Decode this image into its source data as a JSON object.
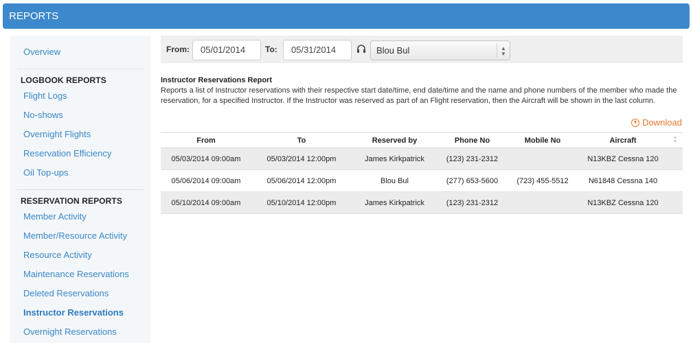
{
  "header": {
    "title": "REPORTS"
  },
  "sidebar": {
    "overview": "Overview",
    "sections": [
      {
        "heading": "LOGBOOK REPORTS",
        "items": [
          "Flight Logs",
          "No-shows",
          "Overnight Flights",
          "Reservation Efficiency",
          "Oil Top-ups"
        ]
      },
      {
        "heading": "RESERVATION REPORTS",
        "items": [
          "Member Activity",
          "Member/Resource Activity",
          "Resource Activity",
          "Maintenance Reservations",
          "Deleted Reservations",
          "Instructor Reservations",
          "Overnight Reservations"
        ]
      }
    ],
    "active_item": "Instructor Reservations"
  },
  "filters": {
    "from_label": "From:",
    "from_value": "05/01/2014",
    "to_label": "To:",
    "to_value": "05/31/2014",
    "instructor_icon": "headset-icon",
    "instructor_selected": "Blou Bul"
  },
  "report": {
    "title": "Instructor Reservations Report",
    "description": "Reports a list of Instructor reservations with their respective start date/time, end date/time and the name and phone numbers of the member who made the reservation, for a specified Instructor. If the Instructor was reserved as part of an Flight reservation, then the Aircraft will be shown in the last column.",
    "download_label": "Download",
    "download_icon": "download-circle-icon",
    "accent_color": "#e8772e"
  },
  "table": {
    "columns": [
      "From",
      "To",
      "Reserved by",
      "Phone No",
      "Mobile No",
      "Aircraft"
    ],
    "rows": [
      [
        "05/03/2014 09:00am",
        "05/03/2014 12:00pm",
        "James Kirkpatrick",
        "(123) 231-2312",
        "",
        "N13KBZ Cessna 120"
      ],
      [
        "05/06/2014 09:00am",
        "05/06/2014 12:00pm",
        "Blou Bul",
        "(277) 653-5600",
        "(723) 455-5512",
        "N61848 Cessna 140"
      ],
      [
        "05/10/2014 09:00am",
        "05/10/2014 12:00pm",
        "James Kirkpatrick",
        "(123) 231-2312",
        "",
        "N13KBZ Cessna 120"
      ]
    ]
  }
}
